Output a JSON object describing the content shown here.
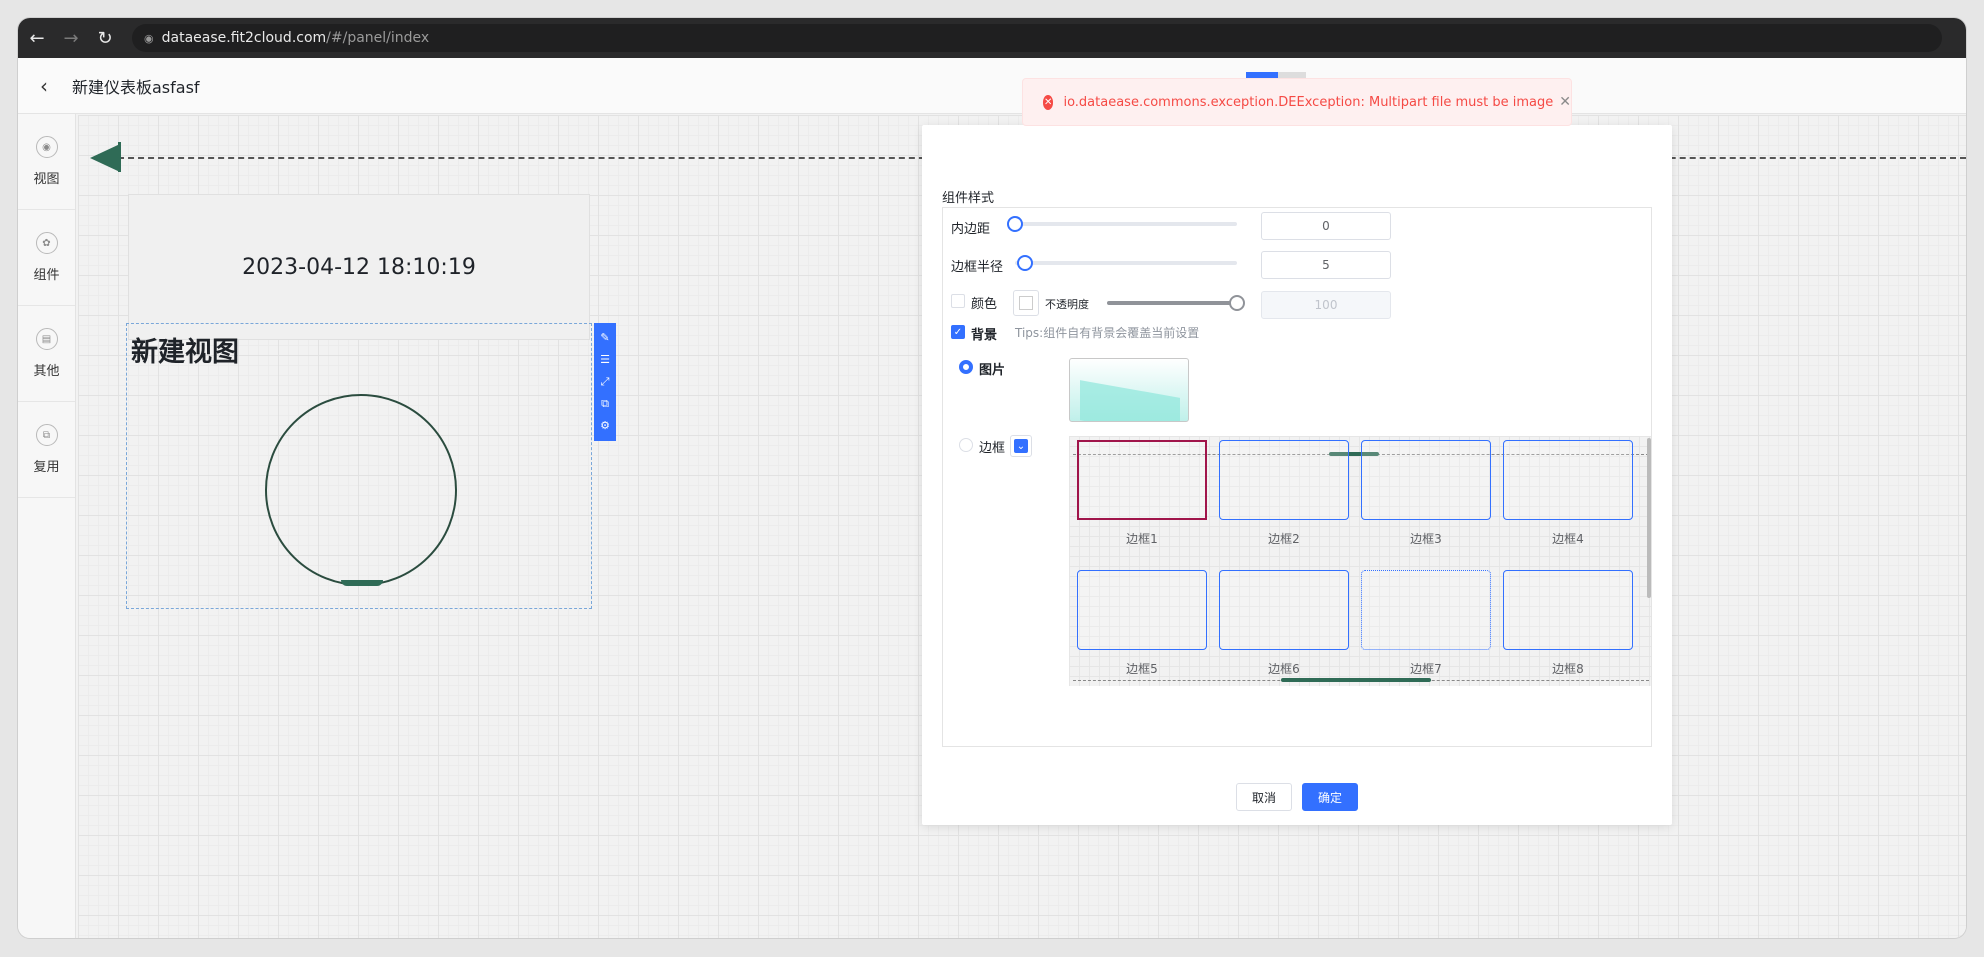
{
  "browser": {
    "url_host": "dataease.fit2cloud.com",
    "url_path": "/#/panel/index"
  },
  "header": {
    "title": "新建仪表板asfasf"
  },
  "sidebar": {
    "items": [
      {
        "label": "视图",
        "icon": "view-icon"
      },
      {
        "label": "组件",
        "icon": "component-icon"
      },
      {
        "label": "其他",
        "icon": "other-icon"
      },
      {
        "label": "复用",
        "icon": "reuse-icon"
      }
    ]
  },
  "canvas": {
    "datetime": "2023-04-12 18:10:19",
    "view_title": "新建视图"
  },
  "toast": {
    "message": "io.dataease.commons.exception.DEException: Multipart file must be image"
  },
  "dialog": {
    "section_title": "组件样式",
    "padding": {
      "label": "内边距",
      "value": "0"
    },
    "radius": {
      "label": "边框半径",
      "value": "5"
    },
    "color": {
      "label": "颜色",
      "opacity_label": "不透明度",
      "opacity_value": "100"
    },
    "background": {
      "label": "背景",
      "tips": "Tips:组件自有背景会覆盖当前设置"
    },
    "image_option": "图片",
    "border_option": "边框",
    "borders": [
      "边框1",
      "边框2",
      "边框3",
      "边框4",
      "边框5",
      "边框6",
      "边框7",
      "边框8"
    ],
    "cancel": "取消",
    "confirm": "确定"
  }
}
